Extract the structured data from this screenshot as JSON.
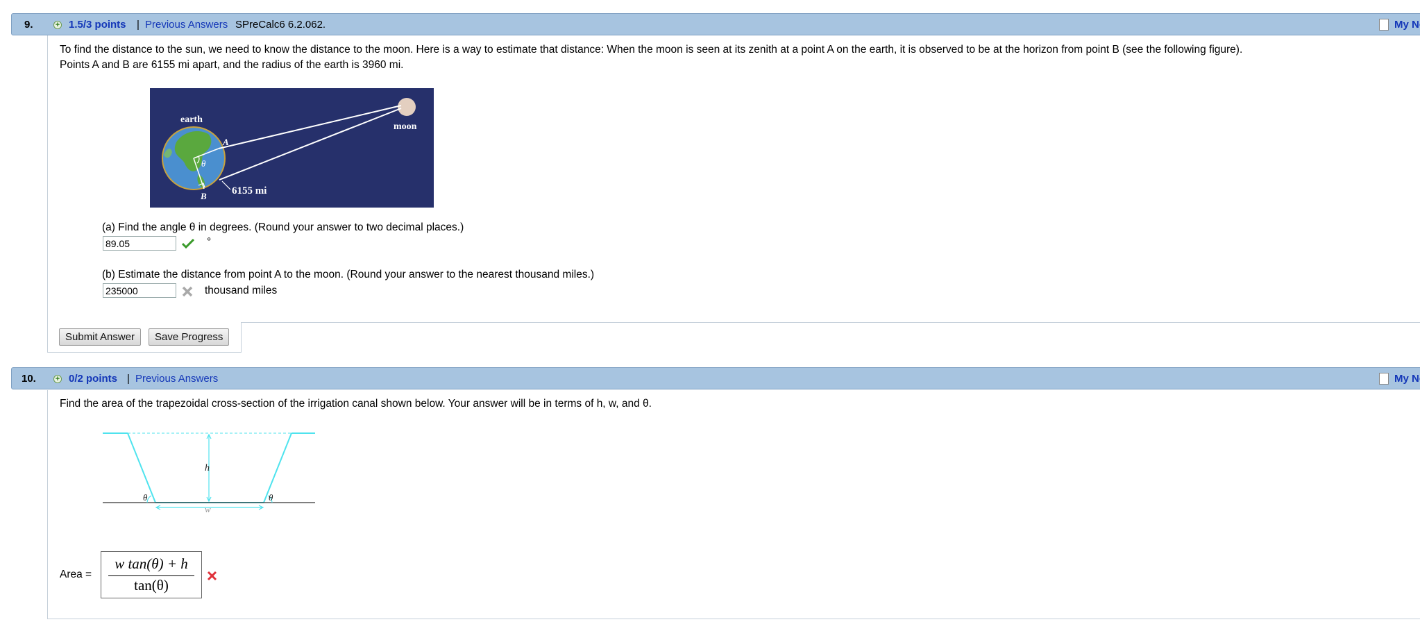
{
  "q9": {
    "number": "9.",
    "points": "1.5/3 points",
    "separator": "|",
    "previous_answers": "Previous Answers",
    "problem_id": "SPreCalc6 6.2.062.",
    "my_notes": "My Notes",
    "text_line1": "To find the distance to the sun, we need to know the distance to the moon. Here is a way to estimate that distance: When the moon is seen at its zenith at a point A on the earth, it is observed to be at the horizon from point B (see the following figure).",
    "text_line2": "Points A and B are 6155 mi apart, and the radius of the earth is 3960 mi.",
    "figure": {
      "earth_label": "earth",
      "moon_label": "moon",
      "point_a": "A",
      "point_b": "B",
      "angle_label": "θ",
      "distance_label": "6155 mi",
      "colors": {
        "background": "#26306b",
        "earth_ocean": "#4a8fcf",
        "earth_land": "#5aa83e",
        "moon": "#e3cfc0"
      }
    },
    "part_a": {
      "prompt": "(a) Find the angle θ in degrees. (Round your answer to two decimal places.)",
      "answer": "89.05",
      "unit": "°",
      "status": "correct"
    },
    "part_b": {
      "prompt": "(b) Estimate the distance from point A to the moon. (Round your answer to the nearest thousand miles.)",
      "answer": "235000",
      "unit": "thousand miles",
      "status": "incorrect"
    },
    "submit_label": "Submit Answer",
    "save_label": "Save Progress"
  },
  "q10": {
    "number": "10.",
    "points": "0/2 points",
    "separator": "|",
    "previous_answers": "Previous Answers",
    "my_notes": "My Notes",
    "text": "Find the area of the trapezoidal cross-section of the irrigation canal shown below. Your answer will be in terms of h, w, and θ.",
    "figure": {
      "h_label": "h",
      "w_label": "w",
      "theta_left": "θ",
      "theta_right": "θ",
      "color": "#4fe3ee"
    },
    "area_label": "Area =",
    "numerator": "w tan(θ) + h",
    "denominator": "tan(θ)",
    "status": "incorrect"
  },
  "colors": {
    "header_bg": "#a7c4e0",
    "link": "#1437b8",
    "correct": "#3a9a2a",
    "incorrect": "#e0313a"
  }
}
